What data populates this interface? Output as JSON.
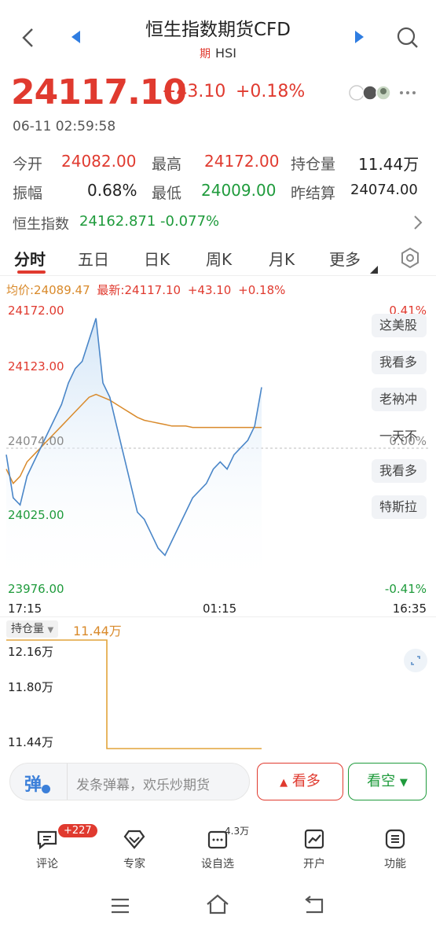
{
  "header": {
    "title": "恒生指数期货CFD",
    "tag": "期",
    "code": "HSI"
  },
  "quote": {
    "price": "24117.10",
    "change": "+43.10",
    "change_pct": "+0.18%",
    "timestamp": "06-11 02:59:58"
  },
  "stats": {
    "open_label": "今开",
    "open": "24082.00",
    "high_label": "最高",
    "high": "24172.00",
    "oi_label": "持仓量",
    "oi": "11.44万",
    "amp_label": "振幅",
    "amp": "0.68%",
    "low_label": "最低",
    "low": "24009.00",
    "prev_label": "昨结算",
    "prev": "24074.00"
  },
  "index": {
    "label": "恒生指数",
    "value": "24162.871",
    "pct": "-0.077%"
  },
  "tabs": [
    "分时",
    "五日",
    "日K",
    "周K",
    "月K",
    "更多"
  ],
  "legend": {
    "avg": "均价:24089.47",
    "latest": "最新:24117.10",
    "chg": "+43.10",
    "pct": "+0.18%"
  },
  "axis": {
    "y_left": [
      "24172.00",
      "24123.00",
      "24074.00",
      "24025.00",
      "23976.00"
    ],
    "y_right": [
      "0.41%",
      "0.00%",
      "-0.41%"
    ],
    "x": [
      "17:15",
      "01:15",
      "16:35"
    ]
  },
  "side_chips": [
    "这美股",
    "我看多",
    "老衲冲",
    "一天不",
    "我看多",
    "特斯拉"
  ],
  "oi_chart": {
    "label": "持仓量",
    "current": "11.44万",
    "y": [
      "12.16万",
      "11.80万",
      "11.44万"
    ]
  },
  "comment": {
    "icon_text": "弹",
    "placeholder": "发条弹幕，欢乐炒期货"
  },
  "actions": {
    "bull": "看多",
    "bear": "看空"
  },
  "bottom_nav": [
    {
      "label": "评论",
      "badge": "+227"
    },
    {
      "label": "专家"
    },
    {
      "label": "设自选",
      "badge": "4.3万"
    },
    {
      "label": "开户"
    },
    {
      "label": "功能"
    }
  ],
  "colors": {
    "up": "#e03a2f",
    "down": "#1f9b3c",
    "price_line": "#4a86c8",
    "avg_line": "#d98a2b"
  },
  "chart_data": {
    "type": "line",
    "title": "",
    "x_ticks": [
      "17:15",
      "01:15",
      "16:35"
    ],
    "ylim": [
      23976,
      24172
    ],
    "baseline": 24074,
    "series": [
      {
        "name": "最新",
        "values": [
          24070,
          24040,
          24035,
          24055,
          24065,
          24075,
          24085,
          24095,
          24105,
          24120,
          24130,
          24135,
          24150,
          24165,
          24120,
          24110,
          24090,
          24070,
          24050,
          24030,
          24025,
          24015,
          24005,
          24000,
          24010,
          24020,
          24030,
          24040,
          24045,
          24050,
          24060,
          24065,
          24060,
          24070,
          24075,
          24080,
          24090,
          24117
        ]
      },
      {
        "name": "均价",
        "values": [
          24060,
          24050,
          24055,
          24065,
          24070,
          24075,
          24080,
          24085,
          24090,
          24095,
          24100,
          24105,
          24110,
          24112,
          24110,
          24108,
          24105,
          24102,
          24099,
          24096,
          24094,
          24093,
          24092,
          24091,
          24090,
          24090,
          24090,
          24089,
          24089,
          24089,
          24089,
          24089,
          24089,
          24089,
          24089,
          24089,
          24089,
          24089
        ]
      }
    ]
  }
}
